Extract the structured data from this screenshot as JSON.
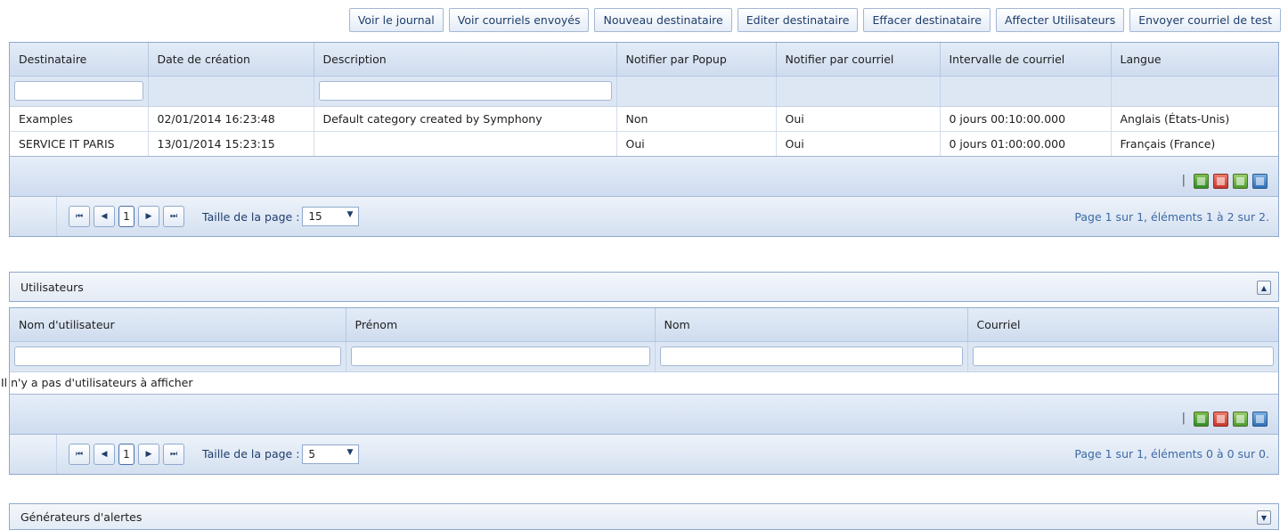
{
  "toolbar": {
    "buttons": [
      "Voir le journal",
      "Voir courriels envoyés",
      "Nouveau destinataire",
      "Editer destinataire",
      "Effacer destinataire",
      "Affecter Utilisateurs",
      "Envoyer courriel de test"
    ]
  },
  "recipients": {
    "columns": [
      "Destinataire",
      "Date de création",
      "Description",
      "Notifier par Popup",
      "Notifier par courriel",
      "Intervalle de courriel",
      "Langue"
    ],
    "rows": [
      [
        "Examples",
        "02/01/2014 16:23:48",
        "Default category created by Symphony",
        "Non",
        "Oui",
        "0 jours 00:10:00.000",
        "Anglais (États-Unis)"
      ],
      [
        "SERVICE IT PARIS",
        "13/01/2014 15:23:15",
        "",
        "Oui",
        "Oui",
        "0 jours 01:00:00.000",
        "Français (France)"
      ]
    ],
    "export_separator": "|",
    "export_icons": [
      "excel-icon",
      "pdf-icon",
      "csv-icon",
      "rtf-icon"
    ],
    "pager": {
      "first": "⏮",
      "prev": "◀",
      "page": "1",
      "next": "▶",
      "last": "⏭",
      "page_size_label": "Taille de la page :",
      "page_size": "15",
      "info": "Page 1 sur 1, éléments 1 à 2 sur 2."
    }
  },
  "users_panel": {
    "title": "Utilisateurs",
    "collapse_symbol": "▲",
    "columns": [
      "Nom d'utilisateur",
      "Prénom",
      "Nom",
      "Courriel"
    ],
    "empty_message": "Il n'y a pas d'utilisateurs à afficher",
    "export_separator": "|",
    "pager": {
      "first": "⏮",
      "prev": "◀",
      "page": "1",
      "next": "▶",
      "last": "⏭",
      "page_size_label": "Taille de la page :",
      "page_size": "5",
      "info": "Page 1 sur 1, éléments 0 à 0 sur 0."
    }
  },
  "alerts_panel": {
    "title": "Générateurs d'alertes",
    "collapse_symbol": "▼"
  },
  "colors": {
    "accent": "#1e3d6b",
    "border": "#8fa9cc",
    "header_bg": "#cfdcef"
  }
}
